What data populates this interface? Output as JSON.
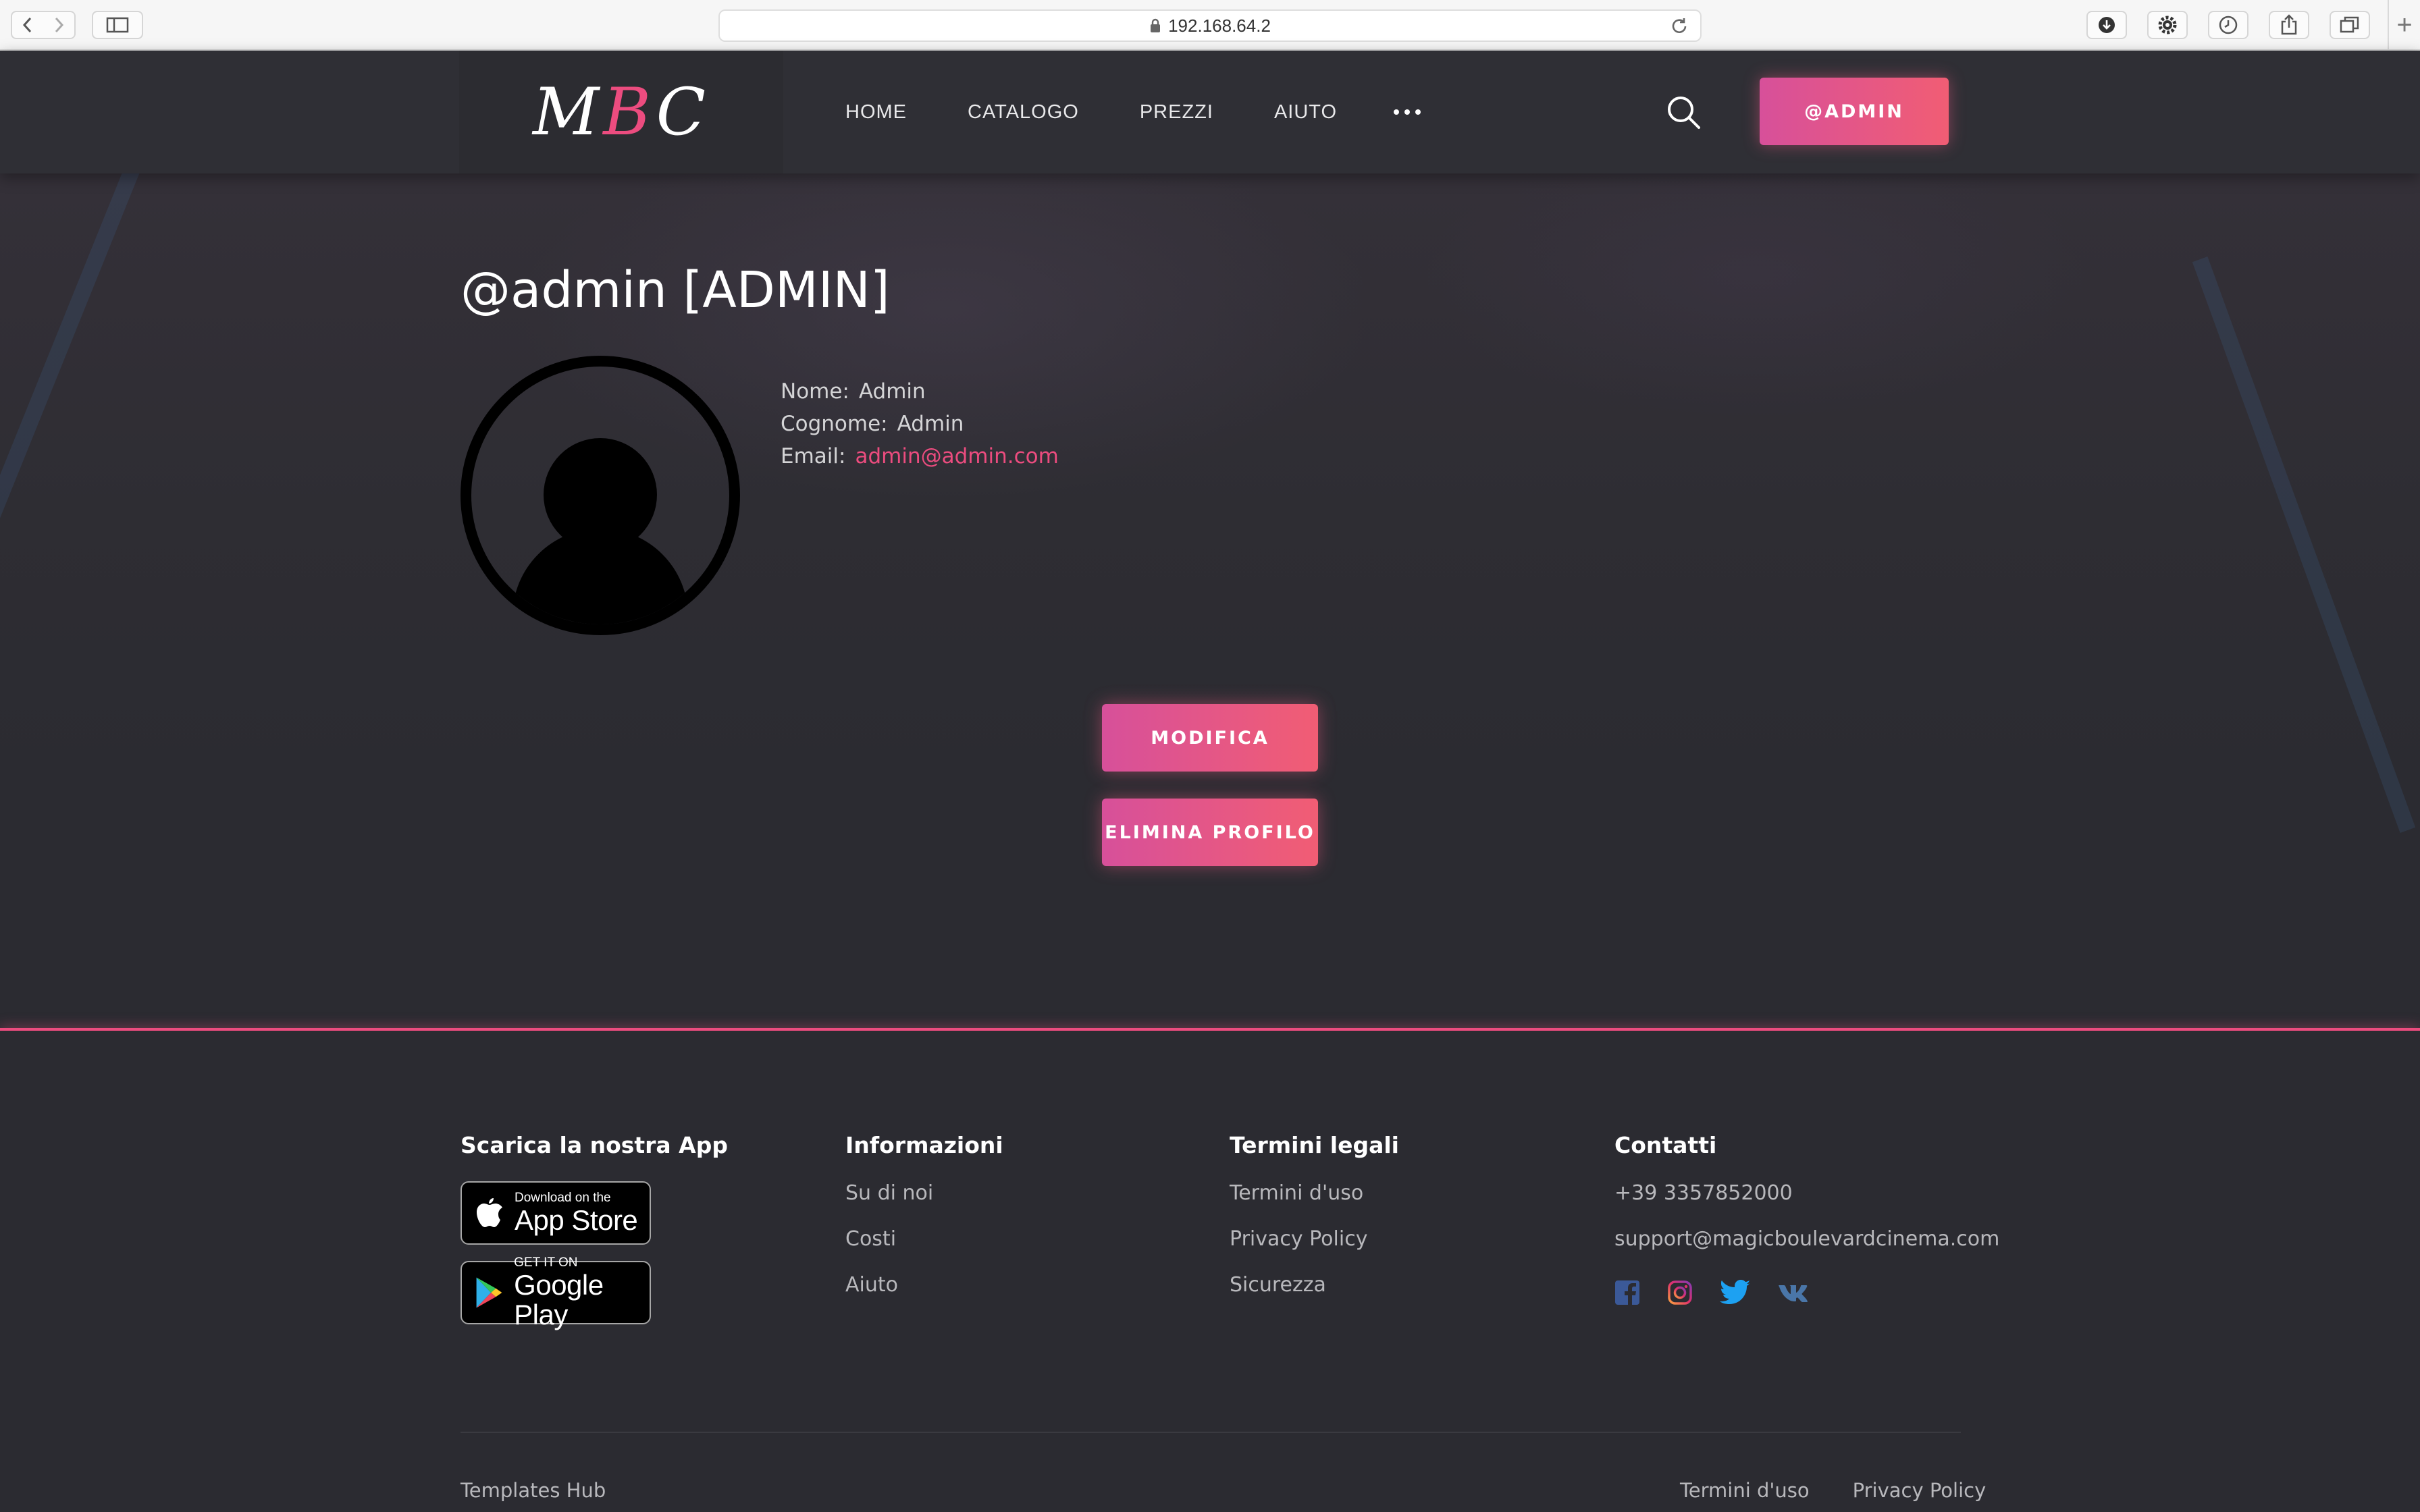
{
  "browser": {
    "url": "192.168.64.2"
  },
  "header": {
    "logo": {
      "letter1": "M",
      "letter2": "B",
      "letter3": "C"
    },
    "nav": [
      "HOME",
      "CATALOGO",
      "PREZZI",
      "AIUTO"
    ],
    "user_button": "@ADMIN"
  },
  "profile": {
    "title": "@admin [ADMIN]",
    "fields": [
      {
        "label": "Nome:",
        "value": "Admin"
      },
      {
        "label": "Cognome:",
        "value": "Admin"
      },
      {
        "label": "Email:",
        "value": "admin@admin.com"
      }
    ],
    "edit_button": "MODIFICA",
    "delete_button": "ELIMINA PROFILO"
  },
  "footer": {
    "app": {
      "title": "Scarica la nostra App",
      "appstore_small": "Download on the",
      "appstore_big": "App Store",
      "googleplay_small": "GET IT ON",
      "googleplay_big": "Google Play"
    },
    "info": {
      "title": "Informazioni",
      "links": [
        "Su di noi",
        "Costi",
        "Aiuto"
      ]
    },
    "legal": {
      "title": "Termini legali",
      "links": [
        "Termini d'uso",
        "Privacy Policy",
        "Sicurezza"
      ]
    },
    "contacts": {
      "title": "Contatti",
      "phone": "+39 3357852000",
      "email": "support@magicboulevardcinema.com",
      "socials": [
        "facebook-icon",
        "instagram-icon",
        "twitter-icon",
        "vk-icon"
      ]
    },
    "copyright": "Templates Hub",
    "bottom_links": [
      "Termini d'uso",
      "Privacy Policy"
    ]
  },
  "colors": {
    "accent": "#ec4c7f",
    "background": "#2b2b31",
    "header": "#2f2f35"
  }
}
